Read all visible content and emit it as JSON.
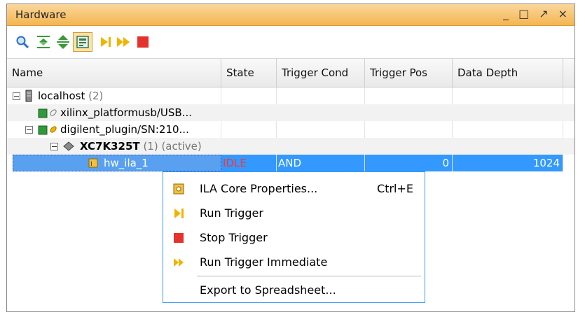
{
  "panel": {
    "title": "Hardware"
  },
  "window_controls": [
    "_",
    "□",
    "↗",
    "×"
  ],
  "toolbar": [
    {
      "name": "search-icon"
    },
    {
      "name": "collapse-all-icon"
    },
    {
      "name": "expand-all-icon"
    },
    {
      "name": "dashboard-icon"
    },
    {
      "name": "run-trigger-icon"
    },
    {
      "name": "run-trigger-immediate-icon"
    },
    {
      "name": "stop-trigger-icon"
    }
  ],
  "columns": [
    "Name",
    "State",
    "Trigger Cond",
    "Trigger Pos",
    "Data Depth"
  ],
  "tree": {
    "host": {
      "label": "localhost",
      "count": "(2)"
    },
    "usb": {
      "label": "xilinx_platformusb/USB..."
    },
    "plugin": {
      "label": "digilent_plugin/SN:210..."
    },
    "device": {
      "label": "XC7K325T",
      "suffix": "(1) (active)"
    },
    "ila": {
      "label": "hw_ila_1",
      "state": "IDLE",
      "trigger_cond": "AND",
      "trigger_pos": "0",
      "data_depth": "1024"
    }
  },
  "context_menu": {
    "items": [
      {
        "label": "ILA Core Properties...",
        "shortcut": "Ctrl+E"
      },
      {
        "label": "Run Trigger"
      },
      {
        "label": "Stop Trigger"
      },
      {
        "label": "Run Trigger Immediate"
      },
      {
        "label": "Export to Spreadsheet..."
      }
    ]
  },
  "colors": {
    "titlebar": "#f4b550",
    "selection": "#3399ff",
    "stop": "#e5322d",
    "run": "#f0b400"
  }
}
